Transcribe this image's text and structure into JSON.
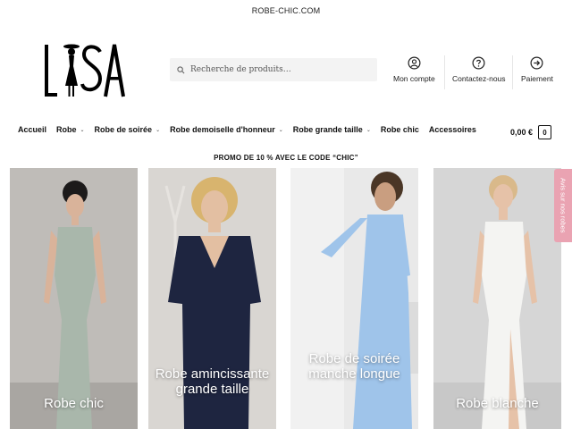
{
  "topbar": {
    "domain": "ROBE-CHIC.COM"
  },
  "logo": {
    "text": "LISA"
  },
  "search": {
    "placeholder": "Recherche de produits…"
  },
  "header_links": [
    {
      "label": "Mon compte",
      "icon": "user-icon"
    },
    {
      "label": "Contactez-nous",
      "icon": "help-circle-icon"
    },
    {
      "label": "Paiement",
      "icon": "arrow-circle-icon"
    }
  ],
  "nav": {
    "items": [
      {
        "label": "Accueil",
        "dropdown": false
      },
      {
        "label": "Robe",
        "dropdown": true
      },
      {
        "label": "Robe de soirée",
        "dropdown": true
      },
      {
        "label": "Robe demoiselle d'honneur",
        "dropdown": true
      },
      {
        "label": "Robe grande taille",
        "dropdown": true
      },
      {
        "label": "Robe chic",
        "dropdown": false
      },
      {
        "label": "Accessoires",
        "dropdown": false
      }
    ],
    "chevron": "⌄"
  },
  "cart": {
    "total": "0,00 €",
    "count": "0"
  },
  "promo": {
    "text": "PROMO DE 10 % AVEC LE CODE “CHIC”"
  },
  "cards": [
    {
      "caption": "Robe chic",
      "dress_color": "#a9b7ab",
      "bg_color": "#bfbcb8"
    },
    {
      "caption": "Robe amincissante grande taille",
      "dress_color": "#1e2540",
      "bg_color": "#d9d6d2"
    },
    {
      "caption": "Robe de soirée manche longue",
      "dress_color": "#9fc4ea",
      "bg_color": "#e9e9e9"
    },
    {
      "caption": "Robe blanche",
      "dress_color": "#f4f4f2",
      "bg_color": "#d6d6d6"
    }
  ],
  "side_tab": {
    "label": "Avis sur nos robes"
  },
  "colors": {
    "accent_pink": "#eaa3b2",
    "search_bg": "#f3f3f3"
  }
}
